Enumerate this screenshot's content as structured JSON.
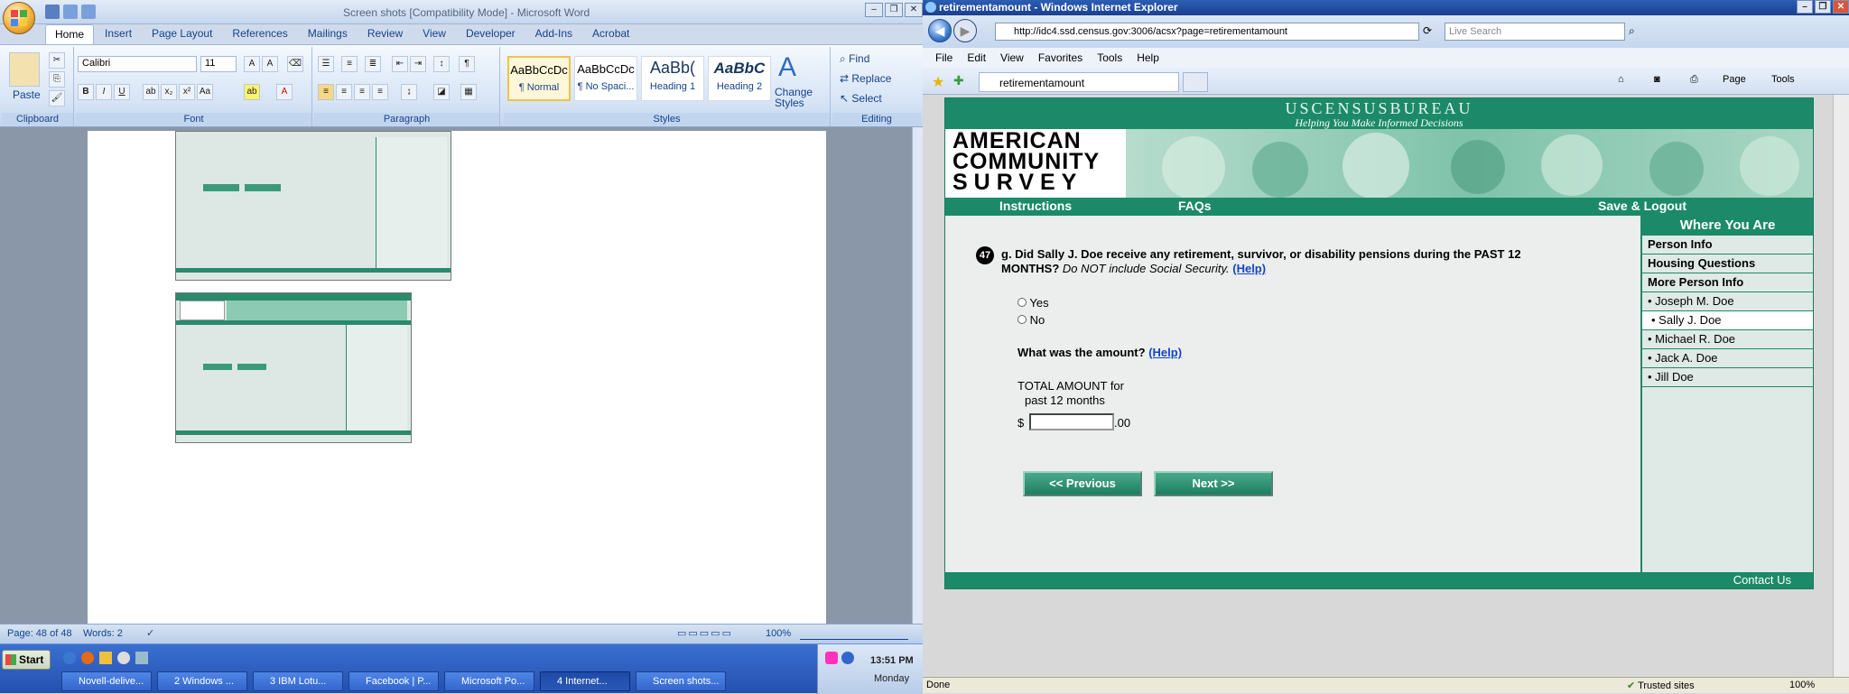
{
  "word": {
    "title": "Screen shots [Compatibility Mode] - Microsoft Word",
    "tabs": [
      "Home",
      "Insert",
      "Page Layout",
      "References",
      "Mailings",
      "Review",
      "View",
      "Developer",
      "Add-Ins",
      "Acrobat"
    ],
    "font_name": "Calibri",
    "font_size": "11",
    "paste_label": "Paste",
    "styles": [
      {
        "preview": "AaBbCcDc",
        "name": "¶ Normal"
      },
      {
        "preview": "AaBbCcDc",
        "name": "¶ No Spaci..."
      },
      {
        "preview": "AaBb(",
        "name": "Heading 1"
      },
      {
        "preview": "AaBbC",
        "name": "Heading 2"
      }
    ],
    "change_styles": "Change\nStyles",
    "editing": {
      "find": "Find",
      "replace": "Replace",
      "select": "Select"
    },
    "groups": {
      "clipboard": "Clipboard",
      "font": "Font",
      "paragraph": "Paragraph",
      "styles": "Styles",
      "editing": "Editing"
    },
    "status": {
      "page": "Page: 48 of 48",
      "words": "Words: 2",
      "zoom": "100%"
    }
  },
  "ie": {
    "title": "retirementamount - Windows Internet Explorer",
    "url": "http://idc4.ssd.census.gov:3006/acsx?page=retirementamount",
    "search_placeholder": "Live Search",
    "menu": [
      "File",
      "Edit",
      "View",
      "Favorites",
      "Tools",
      "Help"
    ],
    "tab_title": "retirementamount",
    "toolbar": {
      "page": "Page",
      "tools": "Tools"
    },
    "status": {
      "left": "Done",
      "zone": "Trusted sites",
      "zoom": "100%"
    }
  },
  "census": {
    "bureau": "USCENSUSBUREAU",
    "tagline": "Helping You Make Informed Decisions",
    "logo_lines": [
      "AMERICAN",
      "COMMUNITY",
      "SURVEY"
    ],
    "nav": {
      "instructions": "Instructions",
      "faqs": "FAQs",
      "save_logout": "Save & Logout"
    },
    "question_number": "47",
    "question_text": "g. Did Sally J. Doe receive any retirement, survivor, or disability pensions during the PAST 12 MONTHS?",
    "question_note": "Do NOT include Social Security.",
    "help": "(Help)",
    "options": [
      "Yes",
      "No"
    ],
    "amount_question": "What was the amount?",
    "amount_label_1": "TOTAL AMOUNT for",
    "amount_label_2": "past 12 months",
    "currency": "$",
    "cents": ".00",
    "amount_value": "",
    "prev_button": "<<  Previous",
    "next_button": "Next  >>",
    "side_header": "Where You Are",
    "side_items": [
      {
        "label": "Person Info",
        "bold": true
      },
      {
        "label": "Housing Questions",
        "bold": true
      },
      {
        "label": "More Person Info",
        "bold": true
      },
      {
        "label": "• Joseph M. Doe",
        "bold": false
      },
      {
        "label": "• Sally J. Doe",
        "bold": false,
        "current": true
      },
      {
        "label": "• Michael R. Doe",
        "bold": false
      },
      {
        "label": "• Jack A. Doe",
        "bold": false
      },
      {
        "label": "• Jill Doe",
        "bold": false
      }
    ],
    "contact": "Contact Us"
  },
  "taskbar": {
    "start": "Start",
    "items": [
      "Novell-delive...",
      "2 Windows ...",
      "3 IBM Lotu...",
      "Facebook | P...",
      "Microsoft Po...",
      "4 Internet...",
      "Screen shots..."
    ],
    "time": "13:51 PM",
    "day": "Monday"
  }
}
